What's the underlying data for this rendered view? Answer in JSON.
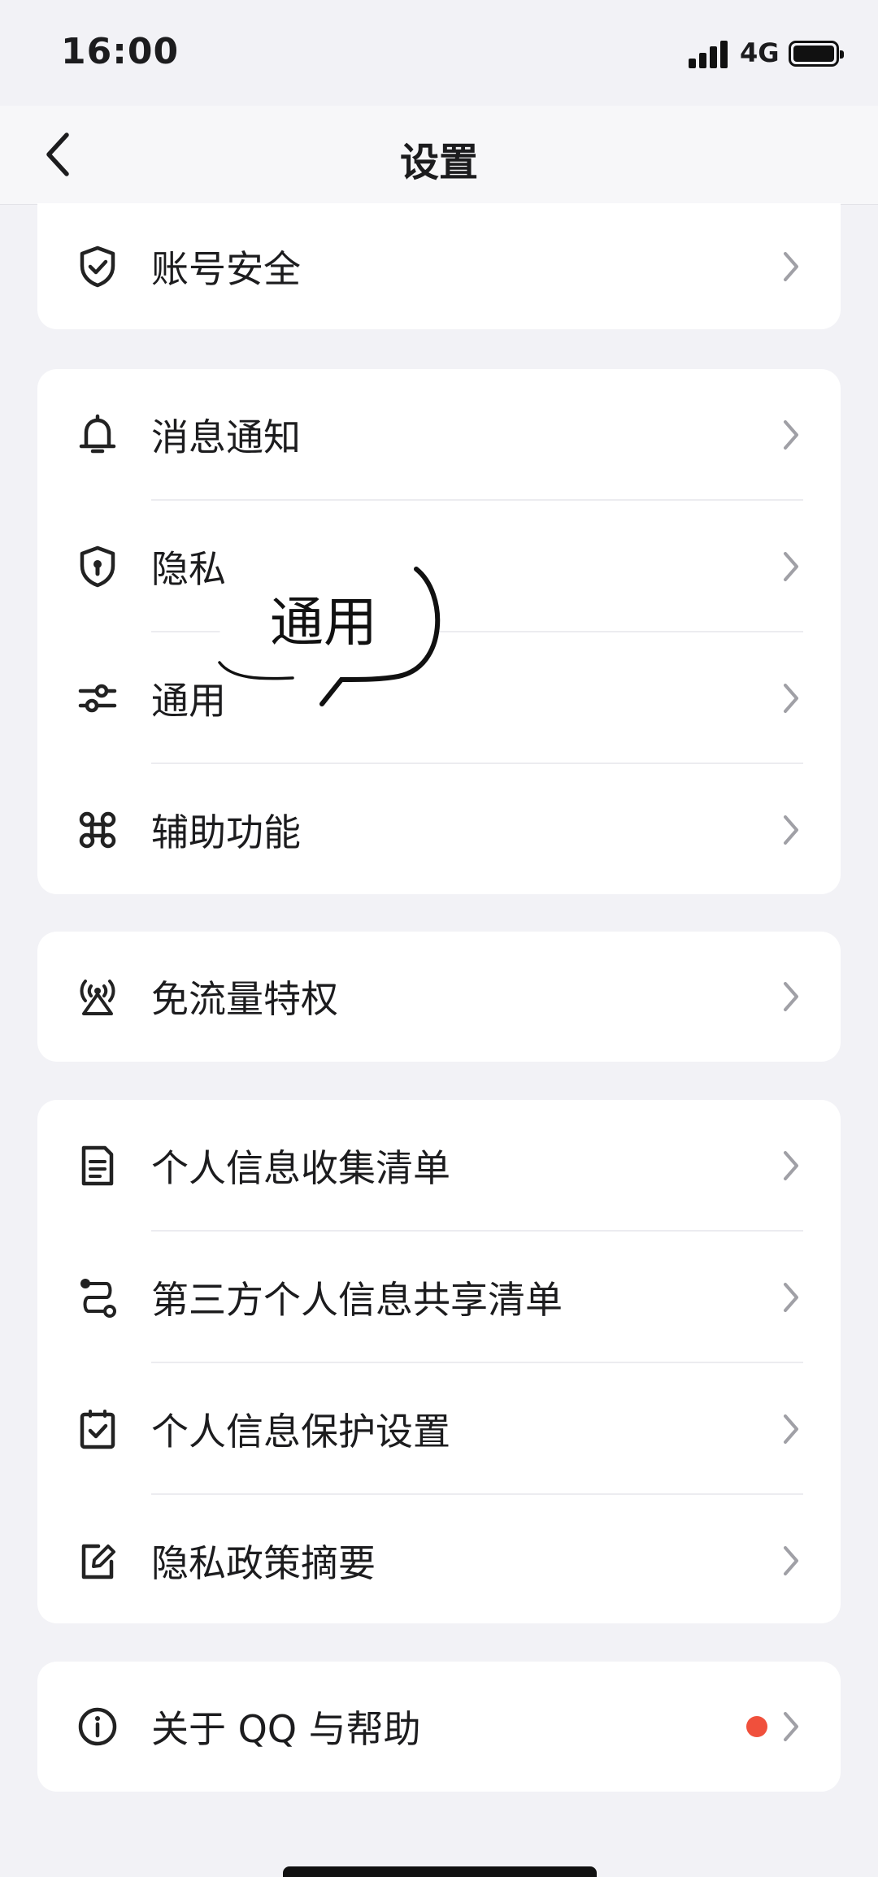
{
  "status_bar": {
    "time": "16:00",
    "network": "4G"
  },
  "nav": {
    "title": "设置",
    "back_icon": "chevron-left-icon"
  },
  "groups": [
    {
      "items": [
        {
          "label": "账号安全",
          "icon": "shield-check-icon"
        }
      ]
    },
    {
      "items": [
        {
          "label": "消息通知",
          "icon": "bell-icon"
        },
        {
          "label": "隐私",
          "icon": "shield-keyhole-icon"
        },
        {
          "label": "通用",
          "icon": "sliders-icon"
        },
        {
          "label": "辅助功能",
          "icon": "command-icon"
        }
      ]
    },
    {
      "items": [
        {
          "label": "免流量特权",
          "icon": "antenna-icon"
        }
      ]
    },
    {
      "items": [
        {
          "label": "个人信息收集清单",
          "icon": "document-icon"
        },
        {
          "label": "第三方个人信息共享清单",
          "icon": "route-icon"
        },
        {
          "label": "个人信息保护设置",
          "icon": "checkbox-icon"
        },
        {
          "label": "隐私政策摘要",
          "icon": "edit-icon"
        }
      ]
    },
    {
      "items": [
        {
          "label": "关于 QQ 与帮助",
          "icon": "info-icon",
          "badge": "red-dot"
        }
      ]
    }
  ],
  "bubble": {
    "text": "通用"
  },
  "colors": {
    "background": "#f2f2f6",
    "card": "#ffffff",
    "badge": "#f0503c"
  }
}
